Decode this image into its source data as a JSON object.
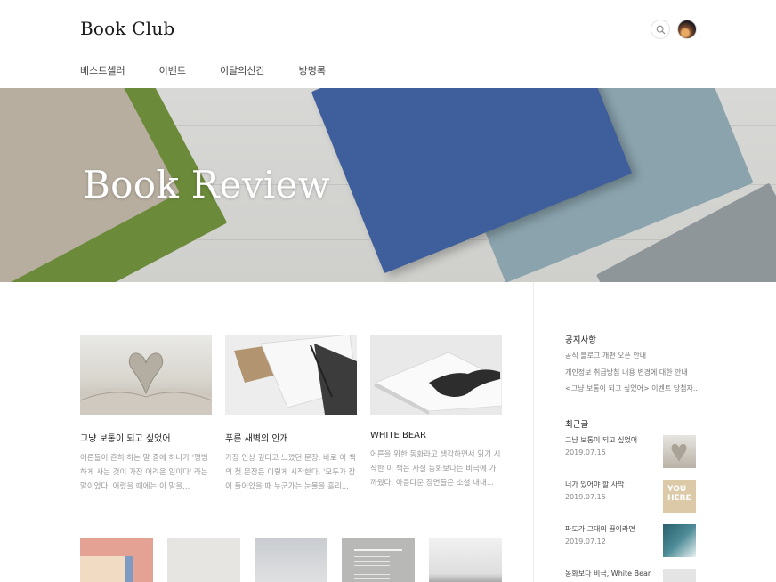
{
  "header": {
    "brand": "Book Club",
    "nav": [
      "베스트셀러",
      "이벤트",
      "이달의신간",
      "방명록"
    ]
  },
  "hero": {
    "title": "Book Review"
  },
  "cards": [
    {
      "title": "그냥 보통이 되고 싶었어",
      "excerpt": "어른들이 흔히 하는 말 중에 하나가 '평범하게 사는 것이 가장 어려운 일이다' 라는 말이었다. 어렸을 때에는 이 말을..."
    },
    {
      "title": "푸른 새벽의 안개",
      "excerpt": "가장 인상 깊다고 느꼈던 문장, 바로 이 책의 첫 문장은 이렇게 시작한다. '모두가 잠이 들어있을 때 누군가는 눈물을 흘리..."
    },
    {
      "title": "WHITE BEAR",
      "excerpt": "어른을 위한 동화라고 생각하면서 읽기 시작한 이 책은 사실 동화보다는 비극에 가까웠다. 아름다운 장면들은 소설 내내..."
    }
  ],
  "sidebar": {
    "notice_heading": "공지사항",
    "notices": [
      "공식 블로그 개편 오픈 안내",
      "개인정보 취급방침 내용 변경에 대한 안내",
      "<그냥 보통이 되고 싶었어> 이벤트 당첨자..."
    ],
    "recent_heading": "최근글",
    "recent": [
      {
        "title": "그냥 보통이 되고 싶었어",
        "date": "2019.07.15"
      },
      {
        "title": "너가 있어야 할 사막",
        "date": "2019.07.15"
      },
      {
        "title": "파도가 그대의 꿈이라면",
        "date": "2019.07.12"
      },
      {
        "title": "동화보다 비극, White Bear",
        "date": ""
      }
    ],
    "recent_thumb_text": "YOU HERE"
  },
  "colors": {
    "hero_blue_book": "#3f5f9c",
    "hero_green_book": "#6b8a3a",
    "hero_gray_blue_book": "#8aa3ad",
    "text_muted": "#9a9a9a"
  }
}
